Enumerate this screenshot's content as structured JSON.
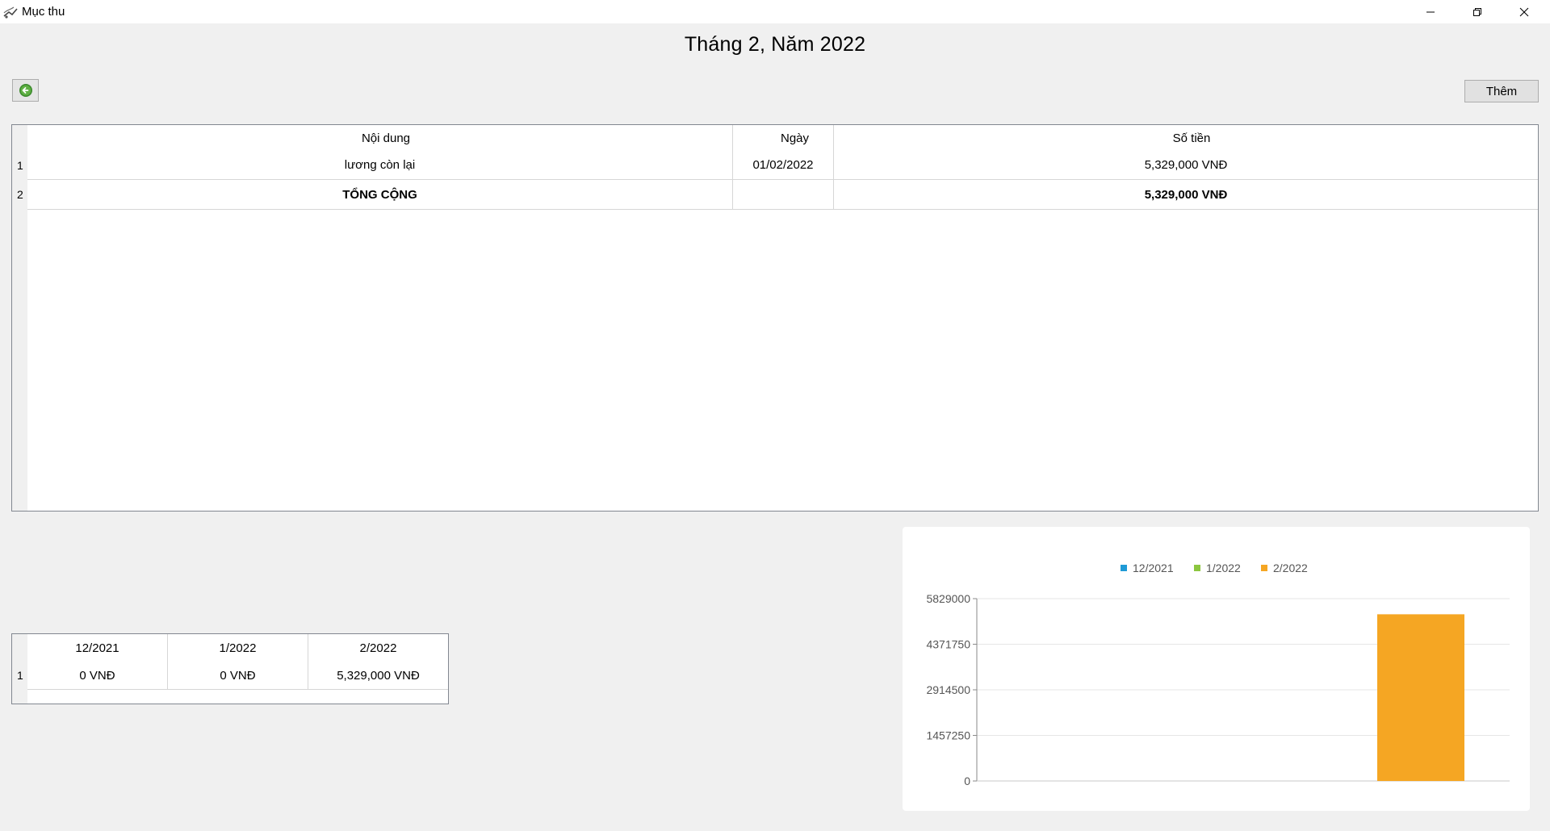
{
  "window": {
    "title": "Mục thu"
  },
  "page": {
    "heading": "Tháng 2, Năm 2022"
  },
  "toolbar": {
    "add_label": "Thêm"
  },
  "main_table": {
    "columns": [
      "Nội dung",
      "Ngày",
      "Số tiền"
    ],
    "rows": [
      {
        "index": "1",
        "content": "lương còn lại",
        "date": "01/02/2022",
        "amount": "5,329,000 VNĐ"
      },
      {
        "index": "2",
        "content": "TỔNG CỘNG",
        "date": "",
        "amount": "5,329,000 VNĐ"
      }
    ]
  },
  "summary_table": {
    "columns": [
      "12/2021",
      "1/2022",
      "2/2022"
    ],
    "rows": [
      {
        "index": "1",
        "values": [
          "0 VNĐ",
          "0 VNĐ",
          "5,329,000 VNĐ"
        ]
      }
    ]
  },
  "chart_data": {
    "type": "bar",
    "categories": [
      "12/2021",
      "1/2022",
      "2/2022"
    ],
    "series": [
      {
        "name": "12/2021",
        "color": "#1f9ad6",
        "values": [
          0
        ]
      },
      {
        "name": "1/2022",
        "color": "#8cc63f",
        "values": [
          0
        ]
      },
      {
        "name": "2/2022",
        "color": "#f5a623",
        "values": [
          5329000
        ]
      }
    ],
    "yticks": [
      "5829000",
      "4371750",
      "2914500",
      "1457250",
      "0"
    ],
    "ylim": [
      0,
      5829000
    ],
    "grid": true,
    "legend": "top-center"
  }
}
